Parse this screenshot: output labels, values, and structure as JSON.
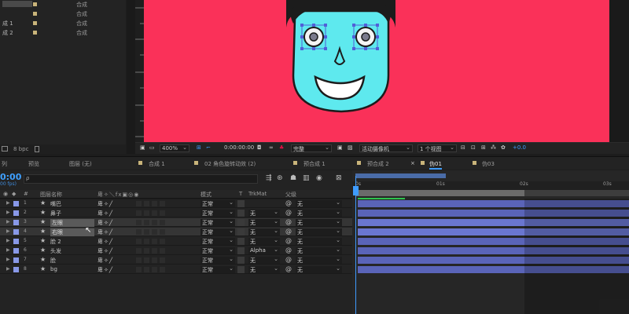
{
  "project": {
    "items": [
      {
        "name": "",
        "type": "合成"
      },
      {
        "name": "",
        "type": "合成"
      },
      {
        "name": "成 1",
        "type": "合成"
      },
      {
        "name": "成 2",
        "type": "合成"
      }
    ],
    "bpc": "8 bpc"
  },
  "viewer": {
    "zoom": "400%",
    "timecode": "0:00:00:00",
    "quality": "完整",
    "camera": "活动摄像机",
    "views": "1 个视图",
    "exposure": "+0.0"
  },
  "tabs": [
    {
      "label": "列"
    },
    {
      "label": "预览"
    },
    {
      "label": "图层 (无)"
    },
    {
      "label": "合成 1"
    },
    {
      "label": "02 角色旋转动效 (2)"
    },
    {
      "label": "预合成 1"
    },
    {
      "label": "预合成 2"
    },
    {
      "label": "伪01"
    },
    {
      "label": "伪03"
    }
  ],
  "timeline": {
    "timecode": "0:00",
    "fps": "00 fps)",
    "search_placeholder": "ρ",
    "columns": {
      "layer_name": "图层名称",
      "mode": "模式",
      "t": "T",
      "trkmat": "TrkMat",
      "parent": "父级"
    },
    "ruler": [
      "0s",
      "01s",
      "02s",
      "03s"
    ],
    "layers": [
      {
        "num": "1",
        "name": "嘴巴",
        "mode": "正常",
        "trkmat": "",
        "parent": "无"
      },
      {
        "num": "2",
        "name": "鼻子",
        "mode": "正常",
        "trkmat": "无",
        "parent": "无"
      },
      {
        "num": "3",
        "name": "左眼",
        "mode": "正常",
        "trkmat": "无",
        "parent": "无"
      },
      {
        "num": "4",
        "name": "右眼",
        "mode": "正常",
        "trkmat": "无",
        "parent": "无"
      },
      {
        "num": "5",
        "name": "脸 2",
        "mode": "正常",
        "trkmat": "无",
        "parent": "无"
      },
      {
        "num": "6",
        "name": "头发",
        "mode": "正常",
        "trkmat": "Alpha",
        "parent": "无"
      },
      {
        "num": "7",
        "name": "脸",
        "mode": "正常",
        "trkmat": "无",
        "parent": "无"
      },
      {
        "num": "8",
        "name": "bg",
        "mode": "正常",
        "trkmat": "无",
        "parent": "无"
      }
    ]
  },
  "colors": {
    "canvas_bg": "#fa3159",
    "face": "#5ee9ee",
    "accent_blue": "#3f9cff",
    "layer_label": "#8898e8",
    "layer_bar": "#5a64b8"
  }
}
